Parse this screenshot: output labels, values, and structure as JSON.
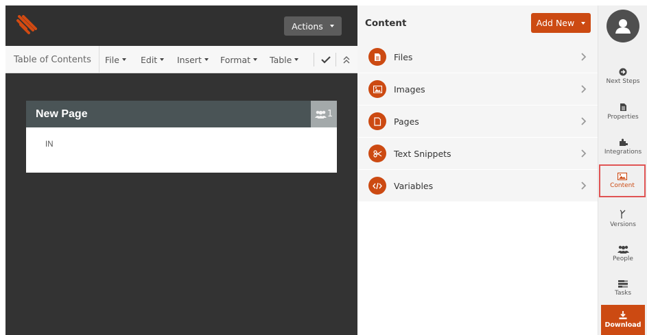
{
  "editor": {
    "actions_label": "Actions",
    "toolbar": {
      "toc": "Table of Contents",
      "file": "File",
      "edit": "Edit",
      "insert": "Insert",
      "format": "Format",
      "table": "Table"
    },
    "page": {
      "title": "New Page",
      "users_count": "1",
      "body_text": "IN"
    }
  },
  "content_panel": {
    "title": "Content",
    "add_new_label": "Add New",
    "items": [
      {
        "label": "Files",
        "icon": "file-icon"
      },
      {
        "label": "Images",
        "icon": "image-icon"
      },
      {
        "label": "Pages",
        "icon": "page-icon"
      },
      {
        "label": "Text Snippets",
        "icon": "scissors-icon"
      },
      {
        "label": "Variables",
        "icon": "code-icon"
      }
    ]
  },
  "sidebar": {
    "items": [
      {
        "label": "Next Steps",
        "icon": "arrow-circle-icon"
      },
      {
        "label": "Properties",
        "icon": "document-icon"
      },
      {
        "label": "Integrations",
        "icon": "puzzle-icon"
      },
      {
        "label": "Content",
        "icon": "image-icon",
        "active": true
      },
      {
        "label": "Versions",
        "icon": "branch-icon"
      },
      {
        "label": "People",
        "icon": "people-icon"
      },
      {
        "label": "Tasks",
        "icon": "tasks-icon"
      }
    ],
    "download_label": "Download"
  },
  "colors": {
    "accent": "#cc4a12",
    "editor_bg": "#333333",
    "page_header": "#4a5456",
    "active_outline": "#e05353"
  }
}
